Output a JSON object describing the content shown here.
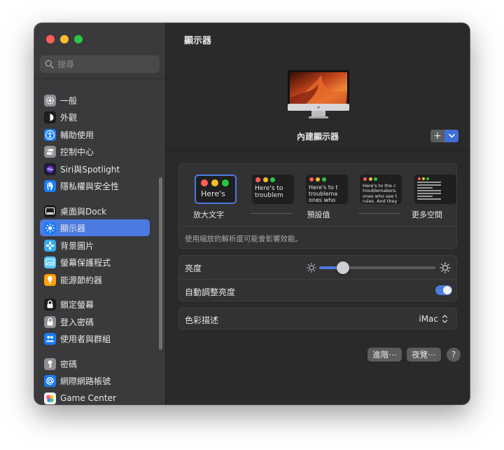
{
  "window": {
    "title": "顯示器",
    "search_placeholder": "搜尋"
  },
  "sidebar": {
    "items": [
      {
        "label": "一般",
        "icon": "gear-icon",
        "color": "#8e8e93"
      },
      {
        "label": "外觀",
        "icon": "appearance-icon",
        "color": "#1c1c1e"
      },
      {
        "label": "輔助使用",
        "icon": "accessibility-icon",
        "color": "#1a7cf5"
      },
      {
        "label": "控制中心",
        "icon": "control-center-icon",
        "color": "#8e8e93"
      },
      {
        "label": "Siri與Spotlight",
        "icon": "siri-icon",
        "color": "#7b3fe4"
      },
      {
        "label": "隱私權與安全性",
        "icon": "hand-icon",
        "color": "#1a7cf5"
      },
      {
        "label": "桌面與Dock",
        "icon": "dock-icon",
        "color": "#1c1c1e"
      },
      {
        "label": "顯示器",
        "icon": "sun-icon",
        "color": "#1a7cf5",
        "selected": true
      },
      {
        "label": "背景圖片",
        "icon": "flower-icon",
        "color": "#35aaf0"
      },
      {
        "label": "螢幕保護程式",
        "icon": "screensaver-icon",
        "color": "#5ac8fa"
      },
      {
        "label": "能源節約器",
        "icon": "bulb-icon",
        "color": "#ff9f0a"
      },
      {
        "label": "鎖定螢幕",
        "icon": "lock-icon",
        "color": "#1c1c1e"
      },
      {
        "label": "登入密碼",
        "icon": "padlock-icon",
        "color": "#8e8e93"
      },
      {
        "label": "使用者與群組",
        "icon": "users-icon",
        "color": "#1a7cf5"
      },
      {
        "label": "密碼",
        "icon": "key-icon",
        "color": "#8e8e93"
      },
      {
        "label": "網際網路帳號",
        "icon": "at-icon",
        "color": "#1a7cf5"
      },
      {
        "label": "Game Center",
        "icon": "game-center-icon",
        "color": "#ffffff"
      }
    ]
  },
  "main": {
    "display_name": "內建顯示器",
    "add_button": "+",
    "resolution": {
      "options": [
        {
          "label": "放大文字",
          "preview": "Here's",
          "selected": true
        },
        {
          "label": "",
          "preview": "Here's to\ntroublem"
        },
        {
          "label": "預設值",
          "preview": "Here's to t\ntroublema\nones who"
        },
        {
          "label": "",
          "preview": "Here's to the c\ntroublemakers.\nones who see t\nrules. And they"
        },
        {
          "label": "更多空間",
          "preview": ""
        }
      ],
      "note": "使用縮放的解析度可能會影響效能。"
    },
    "brightness": {
      "label": "亮度",
      "level": 0.15
    },
    "auto_brightness": {
      "label": "自動調整亮度",
      "enabled": true
    },
    "color_profile": {
      "label": "色彩描述",
      "value": "iMac"
    },
    "buttons": {
      "advanced": "進階⋯",
      "night_shift": "夜覽⋯",
      "help": "?"
    }
  }
}
